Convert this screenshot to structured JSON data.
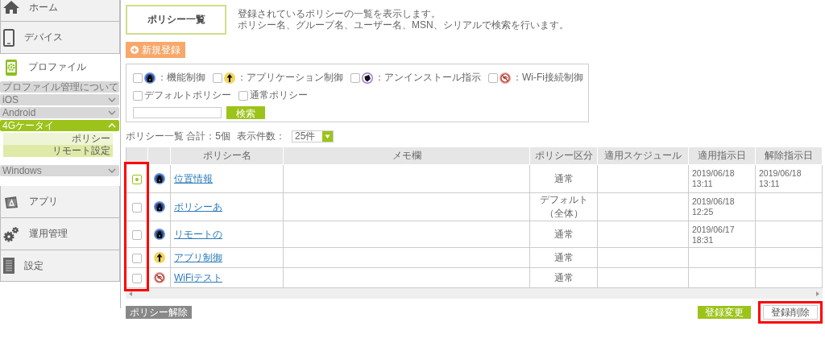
{
  "sidebar": {
    "items": [
      {
        "label": "ホーム",
        "selected": false
      },
      {
        "label": "デバイス",
        "selected": false
      },
      {
        "label": "プロファイル",
        "selected": true,
        "submenu": [
          {
            "label": "プロファイル管理について",
            "kind": "link"
          },
          {
            "label": "iOS",
            "kind": "group",
            "expanded": false
          },
          {
            "label": "Android",
            "kind": "group",
            "expanded": false
          },
          {
            "label": "4Gケータイ",
            "kind": "group",
            "expanded": true,
            "children": [
              {
                "label": "ポリシー",
                "selected": true
              },
              {
                "label": "リモート設定",
                "selected": false
              }
            ]
          },
          {
            "label": "Windows",
            "kind": "group",
            "expanded": false
          }
        ]
      },
      {
        "label": "アプリ",
        "selected": false
      },
      {
        "label": "運用管理",
        "selected": false
      },
      {
        "label": "設定",
        "selected": false
      }
    ]
  },
  "header": {
    "title": "ポリシー一覧",
    "description": [
      "登録されているポリシーの一覧を表示します。",
      "ポリシー名、グループ名、ユーザー名、MSN、シリアルで検索を行います。"
    ]
  },
  "new_button": {
    "label": "新規登録"
  },
  "filters": {
    "type_filters": [
      {
        "kind": "device_control",
        "label": "：機能制御",
        "checked": false
      },
      {
        "kind": "app_control",
        "label": "：アプリケーション制御",
        "checked": false
      },
      {
        "kind": "uninstall",
        "label": "：アンインストール指示",
        "checked": false
      },
      {
        "kind": "wifi",
        "label": "：Wi-Fi接続制御",
        "checked": false
      }
    ],
    "policy_filters": [
      {
        "label": "デフォルトポリシー",
        "checked": false
      },
      {
        "label": "通常ポリシー",
        "checked": false
      }
    ],
    "search_button": "検索"
  },
  "summary": {
    "total": "ポリシー一覧 合計：5個",
    "page_size_label": "表示件数：",
    "page_size": "25件"
  },
  "table": {
    "highlight_checkbox_column": true,
    "columns": [
      "ポリシー名",
      "メモ欄",
      "ポリシー区分",
      "適用スケジュール",
      "適用指示日",
      "解除指示日"
    ],
    "rows": [
      {
        "selected": true,
        "kind": "device_control",
        "name": "位置情報",
        "type": "通常",
        "apply_date": "2019/06/18 13:11",
        "cancel_date": "2019/06/18 13:11"
      },
      {
        "selected": false,
        "kind": "device_control",
        "name": "ポリシーあ",
        "type": "デフォルト（全体）",
        "apply_date": "2019/06/18 12:25"
      },
      {
        "selected": false,
        "kind": "device_control",
        "name": "リモートの",
        "type": "通常",
        "apply_date": "2019/06/17 18:31"
      },
      {
        "selected": false,
        "kind": "app_control",
        "name": "アプリ制御",
        "type": "通常"
      },
      {
        "selected": false,
        "kind": "wifi",
        "name": "WiFiテスト",
        "type": "通常"
      }
    ]
  },
  "actions": {
    "release": "ポリシー解除",
    "change": "登録変更",
    "delete": {
      "label": "登録削除",
      "highlighted": true
    }
  }
}
